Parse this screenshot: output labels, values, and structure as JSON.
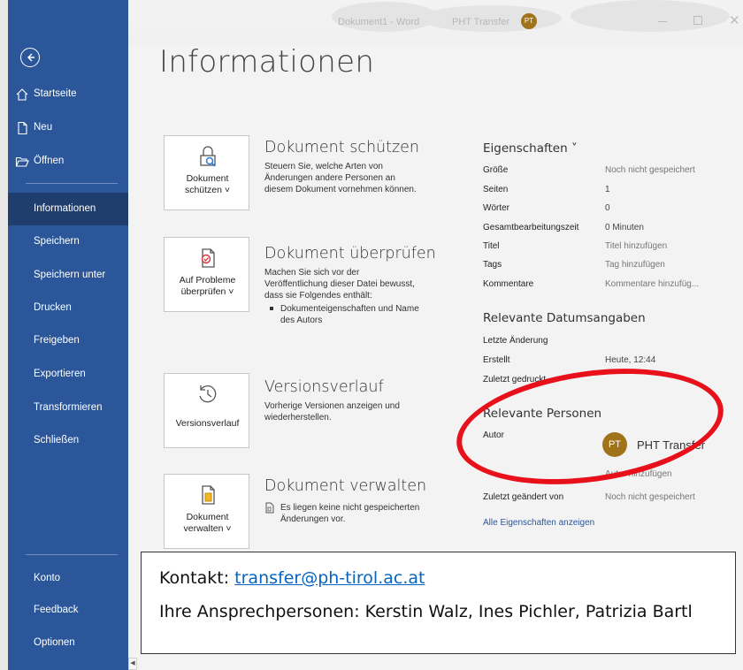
{
  "titlebar": {
    "document": "Dokument1 - Word",
    "user": "PHT Transfer",
    "avatar_initials": "PT"
  },
  "sidebar": {
    "top_items": [
      {
        "label": "Startseite",
        "icon": "home-icon"
      },
      {
        "label": "Neu",
        "icon": "new-document-icon"
      },
      {
        "label": "Öffnen",
        "icon": "folder-open-icon"
      }
    ],
    "items": [
      {
        "label": "Informationen",
        "selected": true
      },
      {
        "label": "Speichern"
      },
      {
        "label": "Speichern unter"
      },
      {
        "label": "Drucken"
      },
      {
        "label": "Freigeben"
      },
      {
        "label": "Exportieren"
      },
      {
        "label": "Transformieren"
      },
      {
        "label": "Schließen"
      }
    ],
    "bottom_items": [
      {
        "label": "Konto"
      },
      {
        "label": "Feedback"
      },
      {
        "label": "Optionen"
      }
    ]
  },
  "main": {
    "title": "Informationen",
    "sections": [
      {
        "tile_label": "Dokument schützen ˅",
        "tile_line1": "Dokument",
        "tile_line2": "schützen ˅",
        "title": "Dokument schützen",
        "desc": "Steuern Sie, welche Arten von Änderungen andere Personen an diesem Dokument vornehmen können."
      },
      {
        "tile_line1": "Auf Probleme",
        "tile_line2": "überprüfen ˅",
        "title": "Dokument überprüfen",
        "desc": "Machen Sie sich vor der Veröffentlichung dieser Datei bewusst, dass sie Folgendes enthält:",
        "bullet": "Dokumenteigenschaften und Name des Autors"
      },
      {
        "tile_line1": "Versionsverlauf",
        "title": "Versionsverlauf",
        "desc": "Vorherige Versionen anzeigen und wiederherstellen."
      },
      {
        "tile_line1": "Dokument",
        "tile_line2": "verwalten ˅",
        "title": "Dokument verwalten",
        "desc": "Es liegen keine nicht gespeicherten Änderungen vor."
      }
    ]
  },
  "properties": {
    "heading": "Eigenschaften ˅",
    "rows": [
      {
        "label": "Größe",
        "value": "Noch nicht gespeichert"
      },
      {
        "label": "Seiten",
        "value": "1"
      },
      {
        "label": "Wörter",
        "value": "0"
      },
      {
        "label": "Gesamtbearbeitungszeit",
        "value": "0 Minuten"
      },
      {
        "label": "Titel",
        "value": "Titel hinzufügen"
      },
      {
        "label": "Tags",
        "value": "Tag hinzufügen"
      },
      {
        "label": "Kommentare",
        "value": "Kommentare hinzufüg..."
      }
    ],
    "dates_heading": "Relevante Datumsangaben",
    "dates": [
      {
        "label": "Letzte Änderung",
        "value": ""
      },
      {
        "label": "Erstellt",
        "value": "Heute, 12:44"
      },
      {
        "label": "Zuletzt gedruckt",
        "value": ""
      }
    ],
    "people_heading": "Relevante Personen",
    "author_label": "Autor",
    "author_initials": "PT",
    "author_name": "PHT Transfer",
    "add_author": "Autor hinzufügen",
    "last_modified_label": "Zuletzt geändert von",
    "last_modified_value": "Noch nicht gespeichert",
    "all_props_link": "Alle Eigenschaften anzeigen"
  },
  "contact": {
    "prefix": "Kontakt: ",
    "email": "transfer@ph-tirol.ac.at",
    "people": "Ihre Ansprechpersonen: Kerstin Walz, Ines Pichler, Patrizia Bartl"
  },
  "colors": {
    "sidebar": "#2b579a",
    "sidebar_selected": "#1f3e6e",
    "avatar": "#a0731b",
    "annotation_ellipse": "#e8101a",
    "link": "#0563c1"
  }
}
